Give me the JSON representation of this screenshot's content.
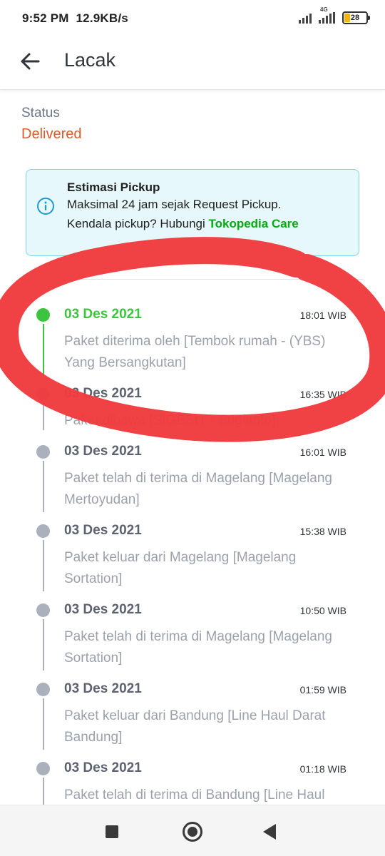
{
  "status_bar": {
    "time": "9:52 PM",
    "speed": "12.9KB/s",
    "network": "4G",
    "battery": "28"
  },
  "header": {
    "title": "Lacak",
    "back_icon": "arrow-left-icon"
  },
  "shipment": {
    "status_label": "Status",
    "status_value": "Delivered",
    "status_color": "#e0582a"
  },
  "info_box": {
    "icon": "info-icon",
    "title": "Estimasi Pickup",
    "line1": "Maksimal 24 jam sejak Request Pickup.",
    "line2_prefix": "Kendala pickup? Hubungi ",
    "link": "Tokopedia Care",
    "link_color": "#03ac0e"
  },
  "timeline": [
    {
      "date": "03 Des 2021",
      "time": "18:01 WIB",
      "desc": "Paket diterima oleh [Tembok rumah - (YBS) Yang Bersangkutan]",
      "active": true
    },
    {
      "date": "03 Des 2021",
      "time": "16:35 WIB",
      "desc": "Paket dibawa [SIGESIT - Sugianto]",
      "active": false
    },
    {
      "date": "03 Des 2021",
      "time": "16:01 WIB",
      "desc": "Paket telah di terima di Magelang [Magelang Mertoyudan]",
      "active": false
    },
    {
      "date": "03 Des 2021",
      "time": "15:38 WIB",
      "desc": "Paket keluar dari Magelang [Magelang Sortation]",
      "active": false
    },
    {
      "date": "03 Des 2021",
      "time": "10:50 WIB",
      "desc": "Paket telah di terima di Magelang [Magelang Sortation]",
      "active": false
    },
    {
      "date": "03 Des 2021",
      "time": "01:59 WIB",
      "desc": "Paket keluar dari Bandung [Line Haul Darat Bandung]",
      "active": false
    },
    {
      "date": "03 Des 2021",
      "time": "01:18 WIB",
      "desc": "Paket telah di terima di Bandung [Line Haul",
      "active": false
    }
  ],
  "colors": {
    "active": "#3cc43f",
    "inactive_dot": "#aab1bd",
    "annotation": "#ef3b3f"
  },
  "nav": {
    "recents_icon": "square-recents-icon",
    "home_icon": "circle-home-icon",
    "back_icon": "triangle-back-icon"
  }
}
